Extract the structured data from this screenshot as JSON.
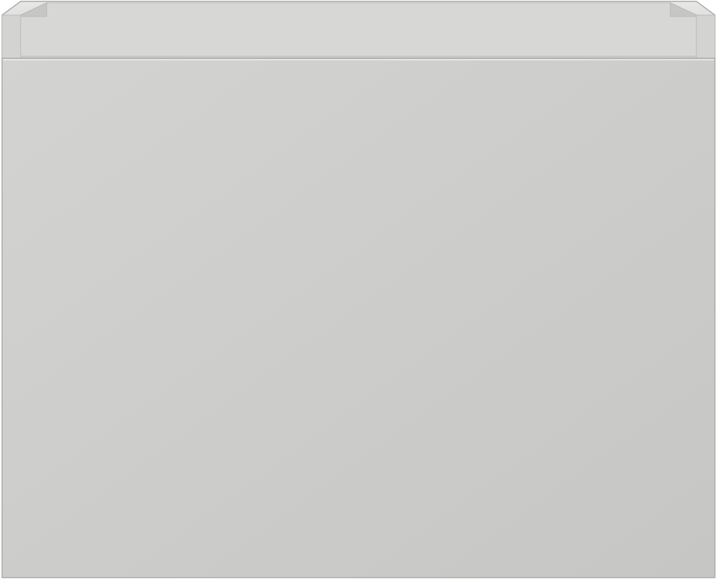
{
  "object": {
    "kind": "wall-hung cabinet with single drawer front, front view",
    "colors": {
      "body": "#cfcfcd",
      "body_light": "#d3d3d1",
      "body_dark": "#c6c6c4",
      "rim_top": "#e7e7e5",
      "inner_back": "#d7d7d5",
      "edge": "#a9a9a7",
      "highlight": "#f0f0ee"
    }
  }
}
